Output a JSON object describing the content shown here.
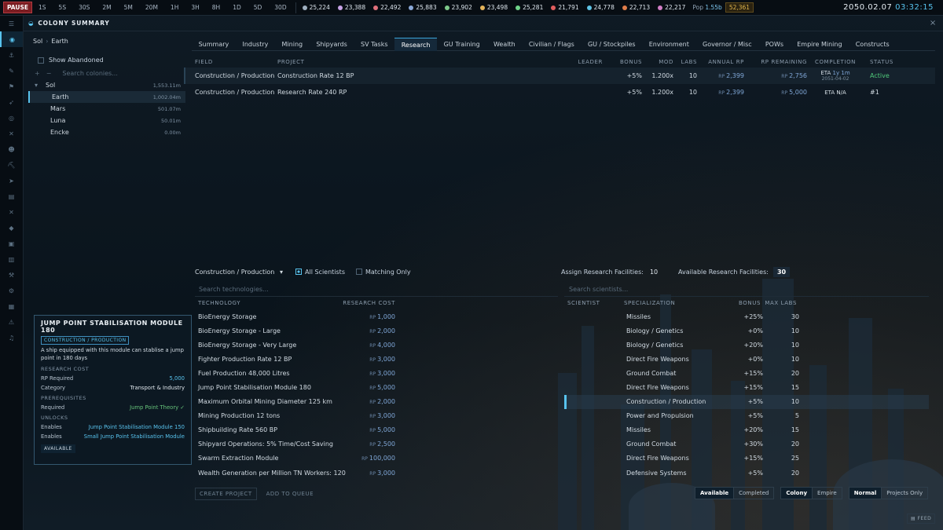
{
  "topbar": {
    "pause": "PAUSE",
    "speeds": [
      "1S",
      "5S",
      "30S",
      "2M",
      "5M",
      "20M",
      "1H",
      "3H",
      "8H",
      "1D",
      "5D",
      "30D"
    ],
    "resources": [
      {
        "value": "25,224",
        "color": "#9fb0c0"
      },
      {
        "value": "23,388",
        "color": "#c7a3e6"
      },
      {
        "value": "22,492",
        "color": "#e0707b"
      },
      {
        "value": "25,883",
        "color": "#8aa8d8"
      },
      {
        "value": "23,902",
        "color": "#7dc98a"
      },
      {
        "value": "23,498",
        "color": "#e3b35a"
      },
      {
        "value": "25,281",
        "color": "#6fd48a"
      },
      {
        "value": "21,791",
        "color": "#e05d5d"
      },
      {
        "value": "24,778",
        "color": "#5fc4e6"
      },
      {
        "value": "22,713",
        "color": "#e07d4a"
      },
      {
        "value": "22,217",
        "color": "#d27ec6"
      }
    ],
    "pop_label": "Pop",
    "pop_value": "1.55b",
    "wealth": "52,361",
    "date": "2050.02.07",
    "time": "03:32:15"
  },
  "header": {
    "title": "COLONY SUMMARY",
    "close": "×"
  },
  "tree": {
    "crumb_system": "Sol",
    "crumb_body": "Earth",
    "show_abandoned": "Show Abandoned",
    "search_placeholder": "Search colonies...",
    "system": {
      "name": "Sol",
      "value": "1,553.11m"
    },
    "colonies": [
      {
        "name": "Earth",
        "value": "1,002.04m"
      },
      {
        "name": "Mars",
        "value": "501.07m"
      },
      {
        "name": "Luna",
        "value": "50.01m"
      },
      {
        "name": "Encke",
        "value": "0.00m"
      }
    ]
  },
  "tabs": [
    "Summary",
    "Industry",
    "Mining",
    "Shipyards",
    "SV Tasks",
    "Research",
    "GU Training",
    "Wealth",
    "Civilian / Flags",
    "GU / Stockpiles",
    "Environment",
    "Governor / Misc",
    "POWs",
    "Empire Mining",
    "Constructs"
  ],
  "projects": {
    "headers": [
      "FIELD",
      "PROJECT",
      "LEADER",
      "BONUS",
      "MOD",
      "LABS",
      "ANNUAL RP",
      "RP REMAINING",
      "COMPLETION",
      "STATUS"
    ],
    "rows": [
      {
        "field": "Construction / Production",
        "project": "Construction Rate 12 BP",
        "leader": "",
        "bonus": "+5%",
        "mod": "1.200x",
        "labs": "10",
        "annual": "2,399",
        "remaining": "2,756",
        "eta_label": "ETA",
        "eta": "1y 1m",
        "eta_date": "2051-04-02",
        "status": "Active"
      },
      {
        "field": "Construction / Production",
        "project": "Research Rate 240 RP",
        "leader": "",
        "bonus": "+5%",
        "mod": "1.200x",
        "labs": "10",
        "annual": "2,399",
        "remaining": "5,000",
        "eta_label": "ETA",
        "eta": "N/A",
        "eta_date": "",
        "status": "#1"
      }
    ],
    "rp_prefix": "RP"
  },
  "tech_tools": {
    "field_select": "Construction / Production",
    "all_scientists": "All Scientists",
    "matching_only": "Matching Only",
    "assign_label": "Assign Research Facilities:",
    "assign_value": "10",
    "available_label": "Available Research Facilities:",
    "available_value": "30"
  },
  "technologies": {
    "search_placeholder": "Search technologies...",
    "headers": [
      "TECHNOLOGY",
      "RESEARCH COST"
    ],
    "rows": [
      {
        "name": "BioEnergy Storage",
        "cost": "1,000"
      },
      {
        "name": "BioEnergy Storage - Large",
        "cost": "2,000"
      },
      {
        "name": "BioEnergy Storage - Very Large",
        "cost": "4,000"
      },
      {
        "name": "Fighter Production Rate 12 BP",
        "cost": "3,000"
      },
      {
        "name": "Fuel Production 48,000 Litres",
        "cost": "3,000"
      },
      {
        "name": "Jump Point Stabilisation Module 180",
        "cost": "5,000"
      },
      {
        "name": "Maximum Orbital Mining Diameter 125 km",
        "cost": "2,000"
      },
      {
        "name": "Mining Production 12 tons",
        "cost": "3,000"
      },
      {
        "name": "Shipbuilding Rate 560 BP",
        "cost": "5,000"
      },
      {
        "name": "Shipyard Operations: 5% Time/Cost Saving",
        "cost": "2,500"
      },
      {
        "name": "Swarm Extraction Module",
        "cost": "100,000"
      },
      {
        "name": "Wealth Generation per Million TN Workers: 120",
        "cost": "3,000"
      }
    ]
  },
  "scientists": {
    "search_placeholder": "Search scientists...",
    "headers": [
      "SCIENTIST",
      "SPECIALIZATION",
      "BONUS",
      "MAX LABS"
    ],
    "rows": [
      {
        "name": "",
        "spec": "Missiles",
        "bonus": "+25%",
        "labs": "30"
      },
      {
        "name": "",
        "spec": "Biology / Genetics",
        "bonus": "+0%",
        "labs": "10"
      },
      {
        "name": "",
        "spec": "Biology / Genetics",
        "bonus": "+20%",
        "labs": "10"
      },
      {
        "name": "",
        "spec": "Direct Fire Weapons",
        "bonus": "+0%",
        "labs": "10"
      },
      {
        "name": "",
        "spec": "Ground Combat",
        "bonus": "+15%",
        "labs": "20"
      },
      {
        "name": "",
        "spec": "Direct Fire Weapons",
        "bonus": "+15%",
        "labs": "15"
      },
      {
        "name": "",
        "spec": "Construction / Production",
        "bonus": "+5%",
        "labs": "10"
      },
      {
        "name": "",
        "spec": "Power and Propulsion",
        "bonus": "+5%",
        "labs": "5"
      },
      {
        "name": "",
        "spec": "Missiles",
        "bonus": "+20%",
        "labs": "15"
      },
      {
        "name": "",
        "spec": "Ground Combat",
        "bonus": "+30%",
        "labs": "20"
      },
      {
        "name": "",
        "spec": "Direct Fire Weapons",
        "bonus": "+15%",
        "labs": "25"
      },
      {
        "name": "",
        "spec": "Defensive Systems",
        "bonus": "+5%",
        "labs": "20"
      }
    ]
  },
  "card": {
    "title": "JUMP POINT STABILISATION MODULE 180",
    "tag": "CONSTRUCTION / PRODUCTION",
    "desc": "A ship equipped with this module can stablise a jump point in 180 days",
    "research_cost": "RESEARCH COST",
    "rp_required_label": "RP Required",
    "rp_required": "5,000",
    "category_label": "Category",
    "category": "Transport & Industry",
    "prereq": "PREREQUISITES",
    "required_label": "Required",
    "required": "Jump Point Theory ✓",
    "unlocks": "UNLOCKS",
    "enables_label": "Enables",
    "enables1": "Jump Point Stabilisation Module 150",
    "enables2": "Small Jump Point Stabilisation Module",
    "available": "AVAILABLE"
  },
  "bottom": {
    "create": "CREATE PROJECT",
    "queue": "ADD TO QUEUE",
    "available": "Available",
    "completed": "Completed",
    "colony": "Colony",
    "empire": "Empire",
    "normal": "Normal",
    "projects_only": "Projects Only",
    "feed": "FEED"
  }
}
